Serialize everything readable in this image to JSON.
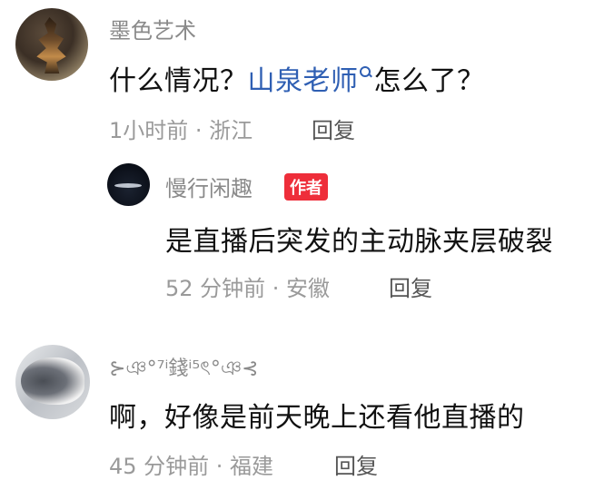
{
  "comments": [
    {
      "username": "墨色艺术",
      "text_before": "什么情况？",
      "mention": "山泉老师",
      "text_after": "怎么了？",
      "meta": "1小时前 · 浙江",
      "reply_label": "回复",
      "avatar_icon": "avatar-image"
    },
    {
      "username": "慢行闲趣",
      "badge": "作者",
      "text": "是直播后突发的主动脉夹层破裂",
      "meta": "52 分钟前 · 安徽",
      "reply_label": "回复",
      "avatar_icon": "avatar-image"
    },
    {
      "username": "⊱ঞ°⁷ⁱ錢ⁱ⁵ৎ°ঞ⊰",
      "text": "啊，好像是前天晚上还看他直播的",
      "meta": "45 分钟前 · 福建",
      "reply_label": "回复",
      "avatar_icon": "cat-avatar-image"
    }
  ],
  "colors": {
    "mention": "#2f5fb3",
    "badge": "#ee2e3a",
    "meta": "#9a9a9a",
    "username": "#8a8a8a"
  }
}
